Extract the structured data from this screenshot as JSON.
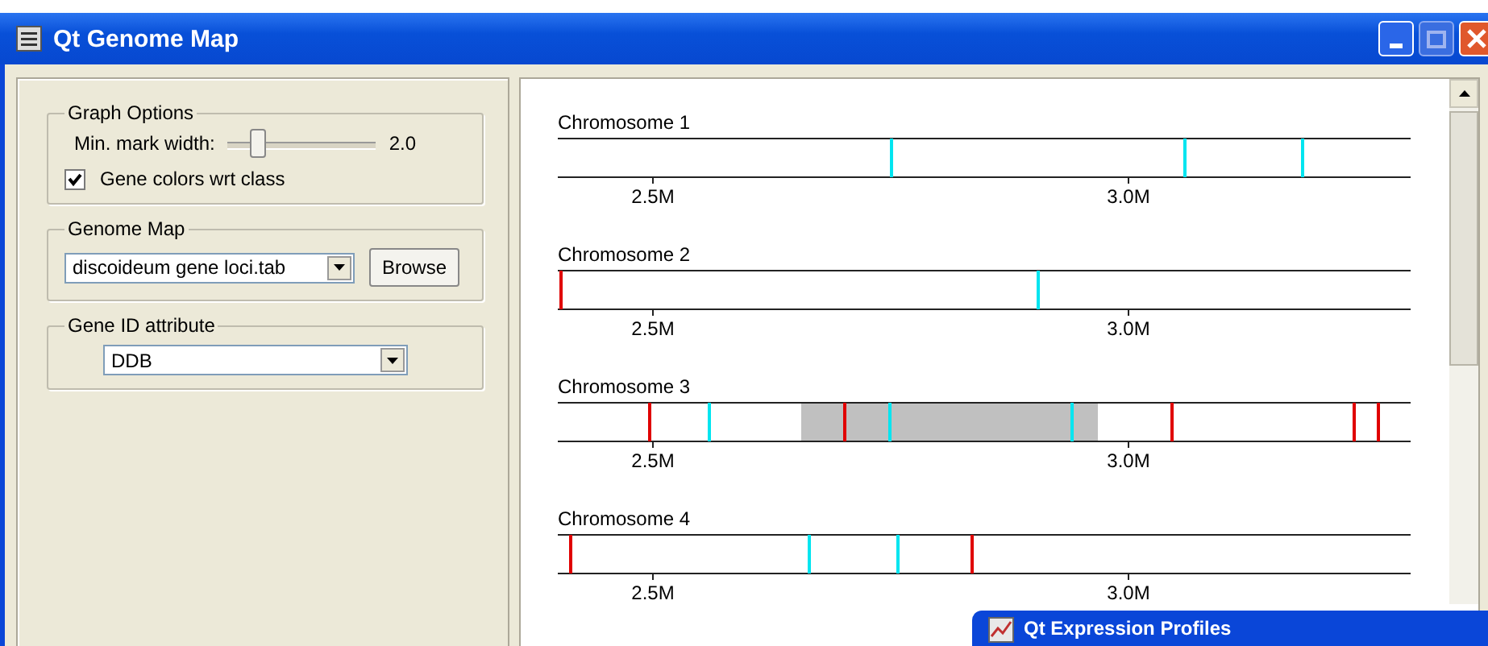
{
  "window": {
    "title": "Qt Genome Map"
  },
  "graph_options": {
    "title": "Graph Options",
    "slider": {
      "label": "Min. mark width:",
      "level": 0.17,
      "reading": "2.0"
    },
    "checkbox": {
      "label": "Gene colors wrt class",
      "checked": true
    }
  },
  "genome_map": {
    "title": "Genome Map",
    "file": "discoideum gene loci.tab",
    "button": "Browse"
  },
  "gene_id": {
    "title": "Gene ID attribute",
    "value": "DDB"
  },
  "chromosomes": [
    {
      "label": "Chromosome 1",
      "ticks": [
        "2.5M",
        "3.0M"
      ]
    },
    {
      "label": "Chromosome 2",
      "ticks": [
        "2.5M",
        "3.0M"
      ]
    },
    {
      "label": "Chromosome 3",
      "ticks": [
        "2.5M",
        "3.0M"
      ]
    },
    {
      "label": "Chromosome 4",
      "ticks": [
        "2.5M",
        "3.0M"
      ]
    }
  ],
  "second_window": {
    "title": "Qt Expression Profiles"
  }
}
